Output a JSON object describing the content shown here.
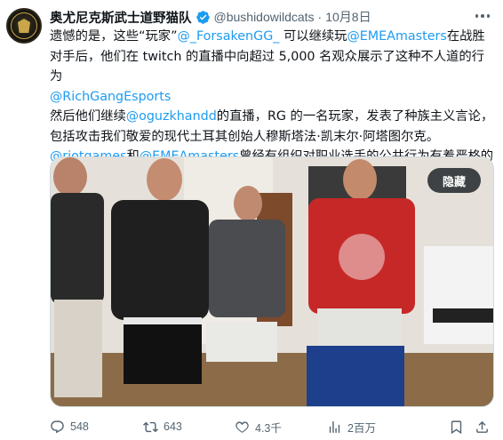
{
  "author": {
    "display_name": "奥尤尼克斯武士道野猫队",
    "handle": "@bushidowildcats",
    "separator": "·",
    "date": "10月8日"
  },
  "tweet": {
    "segments": [
      {
        "text": "遗憾的是，这些“玩家”",
        "link": false
      },
      {
        "text": "@_ForsakenGG_",
        "link": true
      },
      {
        "text": " 可以继续玩",
        "link": false
      },
      {
        "text": "@EMEAmasters",
        "link": true
      },
      {
        "text": "在战胜对手后，他们在 twitch 的直播中向超过 5,000 名观众展示了这种不人道的行为",
        "link": false
      },
      {
        "text": "@RichGangEsports",
        "link": true,
        "br_before": true
      },
      {
        "text": "然后他们继续",
        "link": false,
        "br_before": true
      },
      {
        "text": "@oguzkhandd",
        "link": true
      },
      {
        "text": "的直播，RG 的一名玩家，发表了种族主义言论，包括攻击我们敬爱的现代土耳其创始人穆斯塔法·凯末尔·阿塔图尔克。",
        "link": false
      },
      {
        "text": "@riotgames",
        "link": true,
        "br_before": true
      },
      {
        "text": "和",
        "link": false
      },
      {
        "text": "@EMEAmasters",
        "link": true
      },
      {
        "text": "曾经有组织对职业选手的公共行为有着严格的规定。现在看来情况已经不同了。真可惜",
        "link": false
      }
    ],
    "trailing_emoji": "person-facepalming-emoji"
  },
  "media": {
    "hide_label": "隐藏",
    "kind": "photo"
  },
  "metrics": {
    "replies": "548",
    "reposts": "643",
    "likes": "4.3千",
    "views": "2百万"
  },
  "colors": {
    "link": "#1d9bf0",
    "verified": "#1d9bf0",
    "secondary_text": "#536471"
  },
  "icons": [
    "verified-badge-icon",
    "more-icon",
    "reply-icon",
    "repost-icon",
    "like-icon",
    "views-icon",
    "bookmark-icon",
    "share-icon"
  ]
}
